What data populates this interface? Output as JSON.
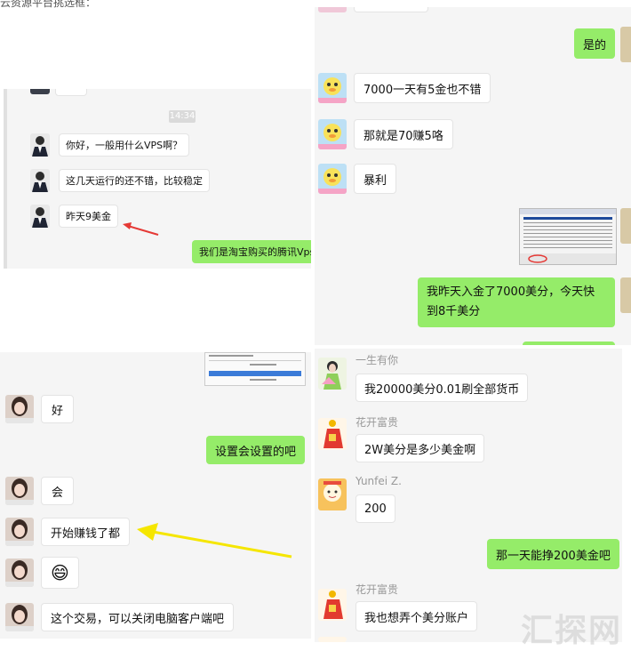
{
  "caption": "云资源平台挑选框：",
  "watermark": "汇探网",
  "panel_top_left": {
    "time": "14:34",
    "messages": [
      "你好，一般用什么VPS啊？",
      "这几天运行的还不错，比较稳定",
      "昨天9美金",
      "我们是淘宝购买的腾讯Vps"
    ]
  },
  "panel_top_right": {
    "messages": [
      "是的",
      "7000一天有5金也不错",
      "那就是70赚5咯",
      "暴利",
      "我昨天入金了7000美分，今天快到8千美分"
    ]
  },
  "panel_bottom_left": {
    "messages": [
      "好",
      "设置会设置的吧",
      "会",
      "开始赚钱了都",
      "😄",
      "这个交易，可以关闭电脑客户端吧"
    ]
  },
  "panel_bottom_right": {
    "names": [
      "一生有你",
      "花开富贵",
      "Yunfei Z.",
      "花开富贵"
    ],
    "messages": [
      "我20000美分0.01刷全部货币",
      "2W美分是多少美金啊",
      "200",
      "那一天能挣200美金吧",
      "我也想弄个美分账户"
    ]
  },
  "colors": {
    "panel_bg": "#f5f5f5",
    "green_bubble": "#95ec69",
    "arrow_red": "#e53935",
    "arrow_yellow": "#f5e600"
  }
}
